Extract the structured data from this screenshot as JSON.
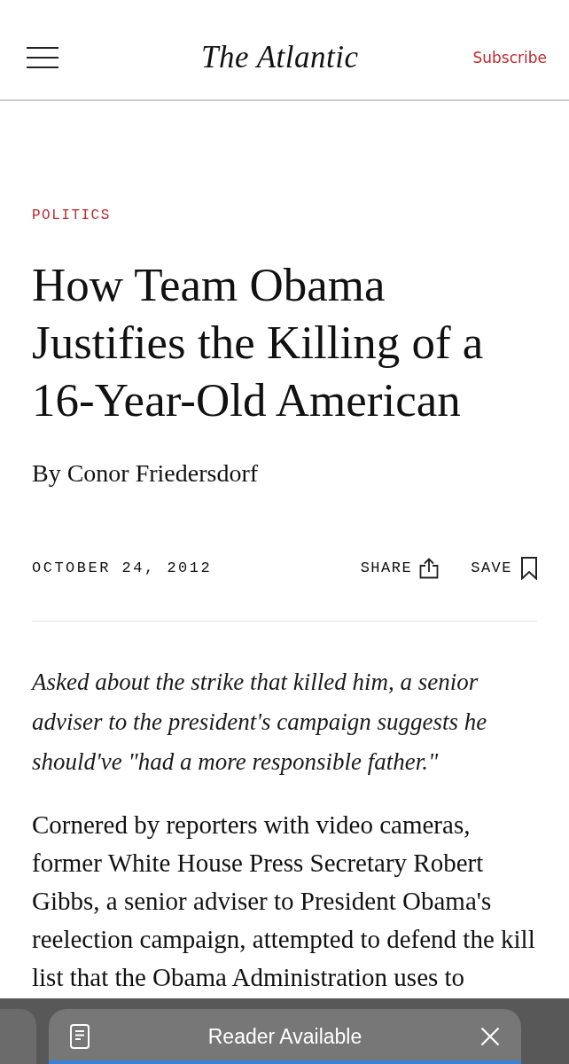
{
  "header": {
    "logo": "The Atlantic",
    "subscribe": "Subscribe"
  },
  "article": {
    "section": "POLITICS",
    "headline_lines": [
      "How Team Obama",
      "Justifies the Killing of a",
      "16-Year-Old American"
    ],
    "byline": "By Conor Friedersdorf",
    "date": "OCTOBER 24, 2012",
    "share": "SHARE",
    "save": "SAVE",
    "dek_lines": [
      "Asked about the strike that killed him, a senior",
      "adviser to the president's campaign suggests he",
      "should've \"had a more responsible father.\""
    ],
    "body_lines": [
      "Cornered by reporters with video cameras,",
      "former White House Press Secretary Robert",
      "Gibbs, a senior adviser to President Obama's",
      "reelection campaign, attempted to defend the kill",
      "list that the Obama Administration uses to"
    ]
  },
  "browser_bar": {
    "reader_label": "Reader Available",
    "load_progress": {
      "level": 1
    }
  }
}
